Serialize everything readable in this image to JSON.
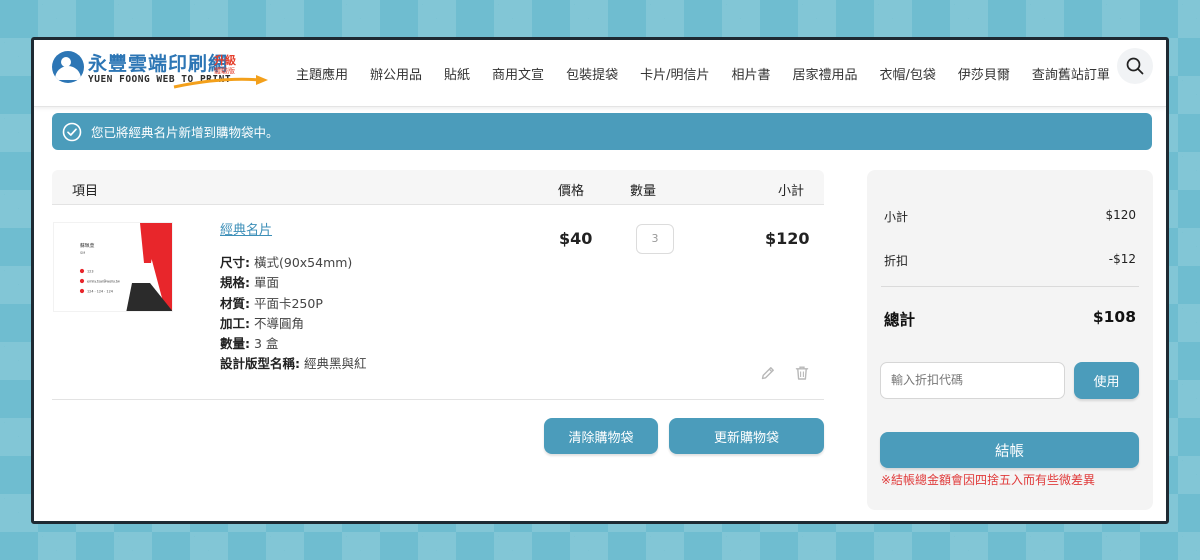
{
  "header": {
    "logo_cn": "永豐雲端印刷網",
    "logo_en": "YUEN FOONG WEB TO PRINT",
    "logo_upgrade": "升級",
    "logo_upgrade_sub": "體驗版",
    "nav": [
      "主題應用",
      "辦公用品",
      "貼紙",
      "商用文宣",
      "包裝提袋",
      "卡片/明信片",
      "相片書",
      "居家禮用品",
      "衣帽/包袋",
      "伊莎貝爾",
      "查詢舊站訂單"
    ]
  },
  "alert": {
    "text": "您已將經典名片新增到購物袋中。"
  },
  "cart": {
    "headers": {
      "item": "項目",
      "price": "價格",
      "qty": "數量",
      "subtotal": "小計"
    },
    "item": {
      "name": "經典名片",
      "card_name": "蘇珮萱",
      "card_title": "SM",
      "card_phone": "123",
      "card_email": "emily.tsai@wolly.tw",
      "card_extra": "124 · 124 · 124",
      "attributes": [
        {
          "label": "尺寸:",
          "value": "橫式(90x54mm)"
        },
        {
          "label": "規格:",
          "value": "單面"
        },
        {
          "label": "材質:",
          "value": "平面卡250P"
        },
        {
          "label": "加工:",
          "value": "不導圓角"
        },
        {
          "label": "數量:",
          "value": "3 盒"
        },
        {
          "label": "設計版型名稱:",
          "value": "經典黑與紅"
        }
      ],
      "price": "$40",
      "qty": "3",
      "subtotal": "$120"
    },
    "clear_label": "清除購物袋",
    "update_label": "更新購物袋"
  },
  "summary": {
    "subtotal_label": "小計",
    "subtotal_value": "$120",
    "discount_label": "折扣",
    "discount_value": "-$12",
    "total_label": "總計",
    "total_value": "$108",
    "coupon_placeholder": "輸入折扣代碼",
    "coupon_button": "使用",
    "checkout_button": "結帳",
    "note": "※結帳總金額會因四捨五入而有些微差異"
  },
  "colors": {
    "accent": "#4b9cbb",
    "warning": "#e03b3b",
    "brand": "#2d76b5",
    "logo_red": "#e53f2c"
  },
  "icons": [
    "logo-mark-icon",
    "search-icon",
    "check-circle-icon",
    "pencil-icon",
    "trash-icon"
  ]
}
